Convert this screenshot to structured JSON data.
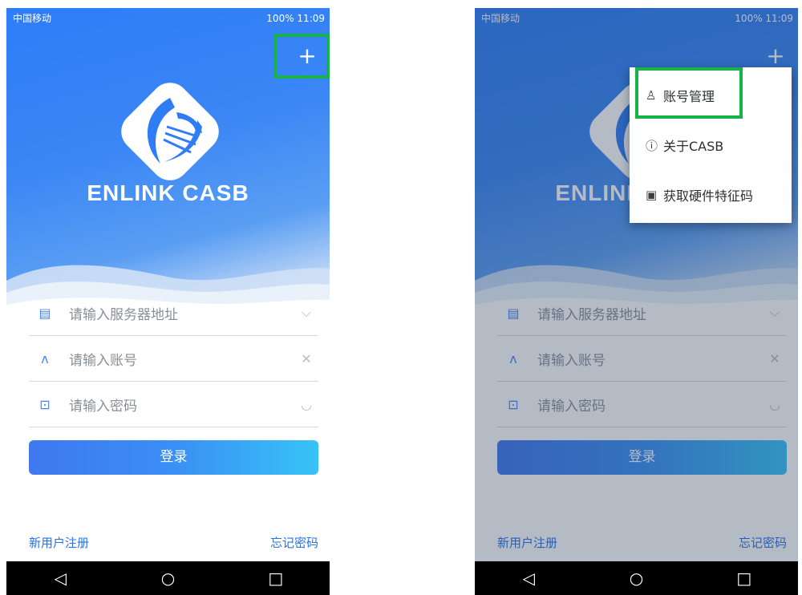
{
  "status": {
    "carrier": "中国移动",
    "right": "100%  11:09"
  },
  "app": {
    "brand": "ENLINK CASB",
    "plus": "+"
  },
  "form": {
    "server_placeholder": "请输入服务器地址",
    "account_placeholder": "请输入账号",
    "password_placeholder": "请输入密码"
  },
  "login_label": "登录",
  "footer": {
    "register": "新用户注册",
    "forgot": "忘记密码"
  },
  "menu": {
    "items": [
      {
        "label": "账号管理",
        "icon": "user-icon"
      },
      {
        "label": "关于CASB",
        "icon": "info-icon"
      },
      {
        "label": "获取硬件特征码",
        "icon": "id-card-icon"
      }
    ]
  },
  "nav": {
    "back": "◁",
    "home": "○",
    "recent": "□"
  },
  "colors": {
    "accent": "#2e7df7",
    "highlight": "#17b34a",
    "link": "#2a70e3"
  }
}
